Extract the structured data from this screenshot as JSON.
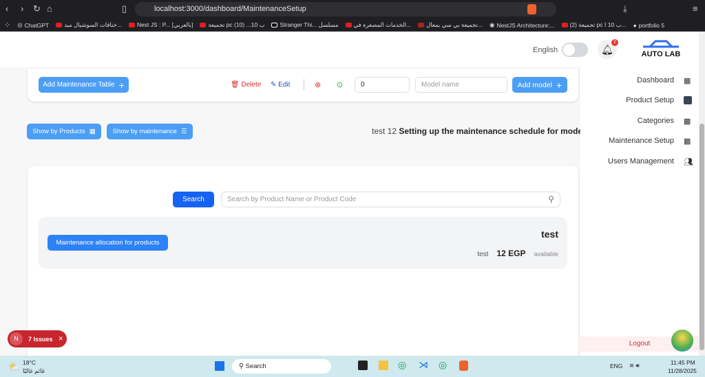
{
  "browser": {
    "url": "localhost:3000/dashboard/MaintenanceSetup",
    "bookmarks": [
      "ChatGPT",
      "خناقات السوشيال ميد...",
      "Nest JS : P... [بالعربي]",
      "تجميعة pc ب 10... (10)",
      "Stranger Thi... مسلسل",
      "الخدمات المصغرة في...",
      "تجميعة بي سي بمعال...",
      "NestJS Architecture:...",
      "(2) تجميعة pc ب 10 ا...",
      "portfolio 5"
    ]
  },
  "header": {
    "language": "English",
    "notifications": "2",
    "logo": "AUTO LAB"
  },
  "toolbar": {
    "add_table": "Add Maintenance Table",
    "delete": "Delete",
    "edit": "Edit",
    "count_value": "0",
    "model_placeholder": "Model name",
    "add_model": "Add model"
  },
  "view": {
    "by_products": "Show by Products",
    "by_maintenance": "Show by maintenance",
    "heading_prefix": "test 12",
    "heading": "Setting up the maintenance schedule for model:"
  },
  "search": {
    "button": "Search",
    "placeholder": "Search by Product Name or Product Code"
  },
  "product": {
    "name": "test",
    "alloc_button": "Maintenance allocation for products",
    "sub": "test",
    "price": "12 EGP",
    "status": "available"
  },
  "sidebar": {
    "items": [
      "Dashboard",
      "Product Setup",
      "Categories",
      "Maintenance Setup",
      "Users Management"
    ],
    "logout": "Logout"
  },
  "issues": {
    "badge": "N",
    "label": "7 Issues"
  },
  "taskbar": {
    "temp": "18°C",
    "weather": "غائم غالبًا",
    "search": "Search",
    "lang": "ENG",
    "time": "11:45 PM",
    "date": "11/28/2025"
  }
}
